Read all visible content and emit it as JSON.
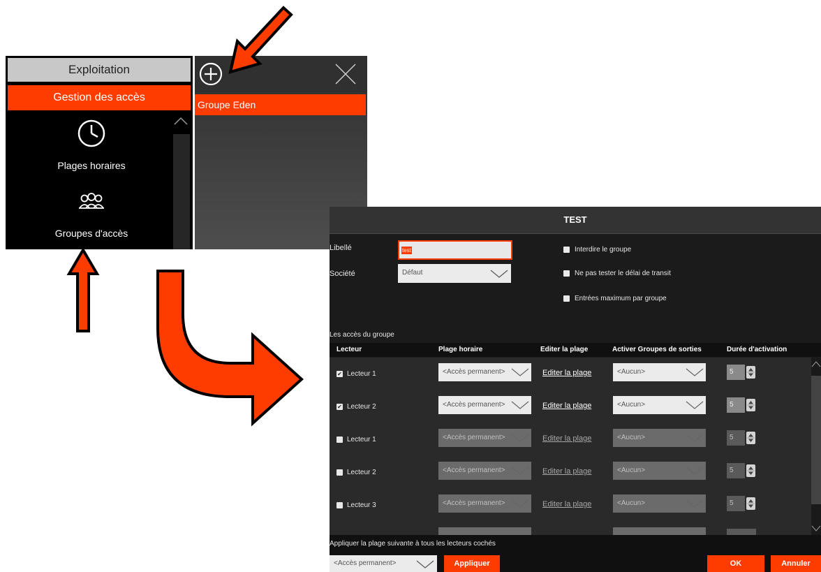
{
  "menu": {
    "header": "Exploitation",
    "active_section": "Gestion des accès",
    "items": [
      {
        "label": "Plages horaires",
        "icon": "clock-icon"
      },
      {
        "label": "Groupes d'accès",
        "icon": "users-icon"
      }
    ]
  },
  "group_list": {
    "add_icon": "plus-circle-icon",
    "close_icon": "close-icon",
    "selected_item": "Groupe Eden"
  },
  "dialog": {
    "title": "TEST",
    "libelle_label": "Libellé",
    "libelle_value": "test",
    "societe_label": "Société",
    "societe_value": "Défaut",
    "options": [
      {
        "label": "Interdire le groupe",
        "checked": false
      },
      {
        "label": "Ne pas tester le délai de transit",
        "checked": false
      },
      {
        "label": "Entrées maximum par groupe",
        "checked": false
      }
    ],
    "section_label": "Les accès du groupe",
    "columns": [
      "Lecteur",
      "Plage horaire",
      "Editer la plage",
      "Activer Groupes de sorties",
      "Durée d'activation"
    ],
    "rows": [
      {
        "reader": "Lecteur 1",
        "checked": true,
        "schedule": "<Accès permanent>",
        "edit": "Editer la plage",
        "output_group": "<Aucun>",
        "duration": "5",
        "enabled": true
      },
      {
        "reader": "Lecteur 2",
        "checked": true,
        "schedule": "<Accès permanent>",
        "edit": "Editer la plage",
        "output_group": "<Aucun>",
        "duration": "5",
        "enabled": true
      },
      {
        "reader": "Lecteur 1",
        "checked": false,
        "schedule": "<Accès permanent>",
        "edit": "Editer la plage",
        "output_group": "<Aucun>",
        "duration": "5",
        "enabled": false
      },
      {
        "reader": "Lecteur 2",
        "checked": false,
        "schedule": "<Accès permanent>",
        "edit": "Editer la plage",
        "output_group": "<Aucun>",
        "duration": "5",
        "enabled": false
      },
      {
        "reader": "Lecteur 3",
        "checked": false,
        "schedule": "<Accès permanent>",
        "edit": "Editer la plage",
        "output_group": "<Aucun>",
        "duration": "5",
        "enabled": false
      }
    ],
    "apply_label": "Appliquer la plage suivante à tous les lecteurs cochés",
    "apply_schedule": "<Accès permanent>",
    "apply_button": "Appliquer",
    "ok_button": "OK",
    "cancel_button": "Annuler"
  },
  "colors": {
    "accent": "#ff3c00",
    "panel_black": "#000000",
    "dialog_bg": "#1b1b1b",
    "annotation_arrow": "#ff3c00"
  }
}
